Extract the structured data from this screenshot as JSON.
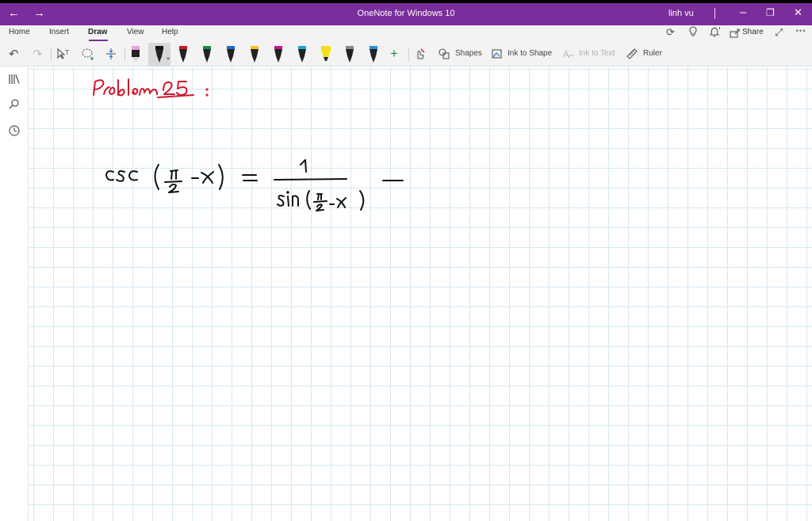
{
  "window": {
    "title": "OneNote for Windows 10",
    "user": "linh vu"
  },
  "tabs": [
    {
      "label": "Home"
    },
    {
      "label": "Insert"
    },
    {
      "label": "Draw",
      "active": true
    },
    {
      "label": "View"
    },
    {
      "label": "Help"
    }
  ],
  "ribbon_right": {
    "share_label": "Share"
  },
  "toolbar": {
    "shapes_label": "Shapes",
    "ink_to_shape_label": "Ink to Shape",
    "ink_to_text_label": "Ink to Text",
    "ruler_label": "Ruler"
  },
  "pens": [
    {
      "color": "#222222",
      "tip": "#e9a6d9",
      "type": "pencil"
    },
    {
      "color": "#222222",
      "tip": "#111111",
      "type": "pen",
      "selected": true
    },
    {
      "color": "#222222",
      "tip": "#d0192b",
      "type": "pen"
    },
    {
      "color": "#222222",
      "tip": "#1a8f3c",
      "type": "pen"
    },
    {
      "color": "#222222",
      "tip": "#1f6ecf",
      "type": "pen"
    },
    {
      "color": "#222222",
      "tip": "#f2c320",
      "type": "pen"
    },
    {
      "color": "#222222",
      "tip": "#c8168a",
      "type": "pen"
    },
    {
      "color": "#222222",
      "tip": "#1fa6d8",
      "type": "pen"
    },
    {
      "color": "#222222",
      "tip": "#f5e11a",
      "type": "highlighter"
    },
    {
      "color": "#222222",
      "tip": "#8a8a8a",
      "type": "pen"
    },
    {
      "color": "#222222",
      "tip": "#2b8fd6",
      "type": "pen"
    }
  ],
  "colors": {
    "accent": "#7b2d9b",
    "grid": "#d6e8f2",
    "ink_red": "#d0192b",
    "ink_black": "#111111"
  },
  "note": {
    "heading_ink": "Problem 25 :",
    "equation_ink": "csc(π/2 − x) = 1 / sin(π/2 − x) −"
  }
}
